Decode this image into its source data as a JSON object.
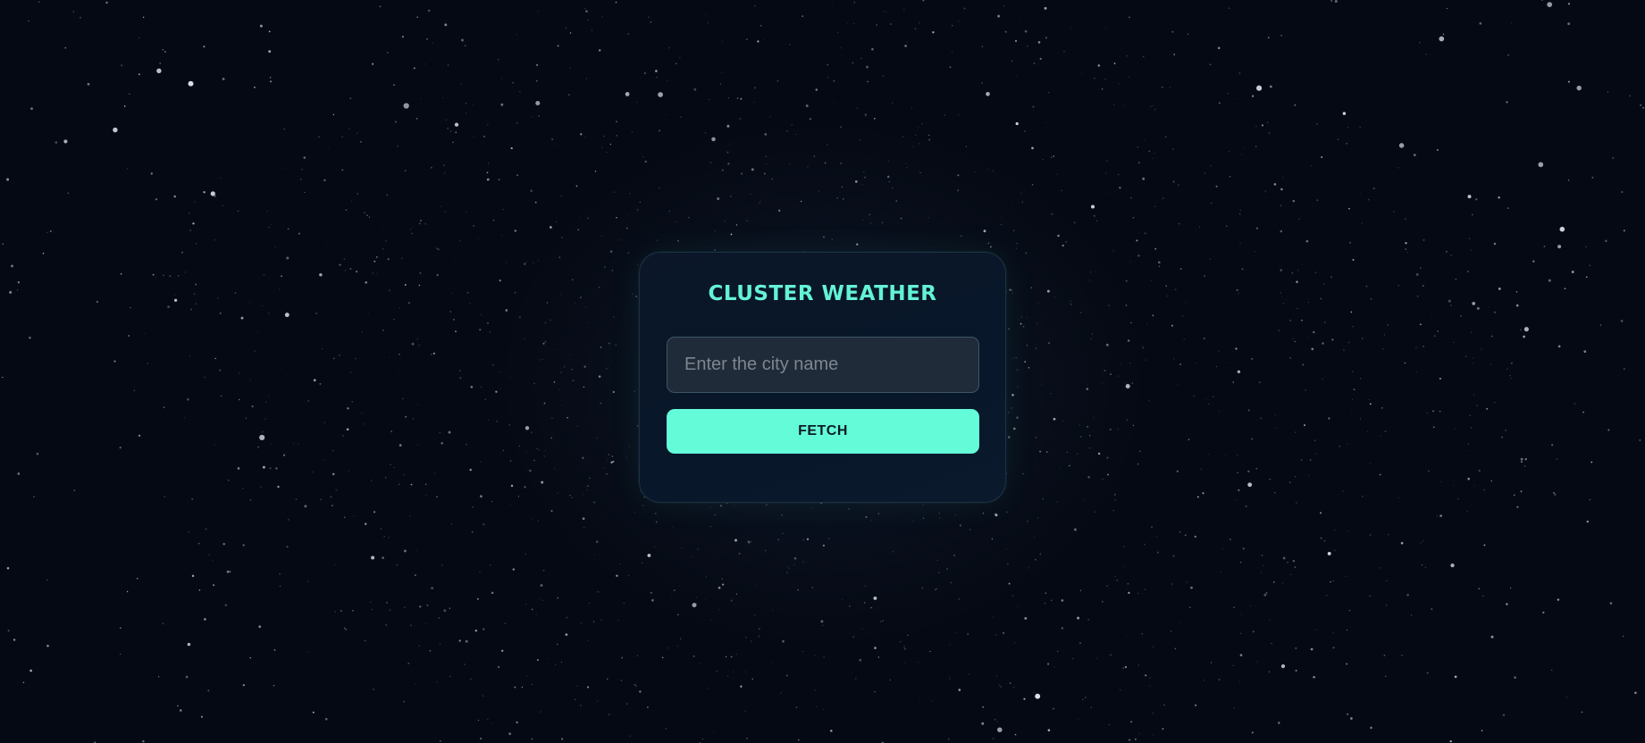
{
  "app": {
    "title": "CLUSTER WEATHER"
  },
  "search": {
    "value": "",
    "placeholder": "Enter the city name"
  },
  "actions": {
    "fetch_label": "FETCH"
  },
  "colors": {
    "background": "#050913",
    "card": "#0a1a2c",
    "accent": "#64fbd9",
    "title": "#64f2d5",
    "input_background": "#202b39",
    "button_text": "#0c1a24"
  }
}
